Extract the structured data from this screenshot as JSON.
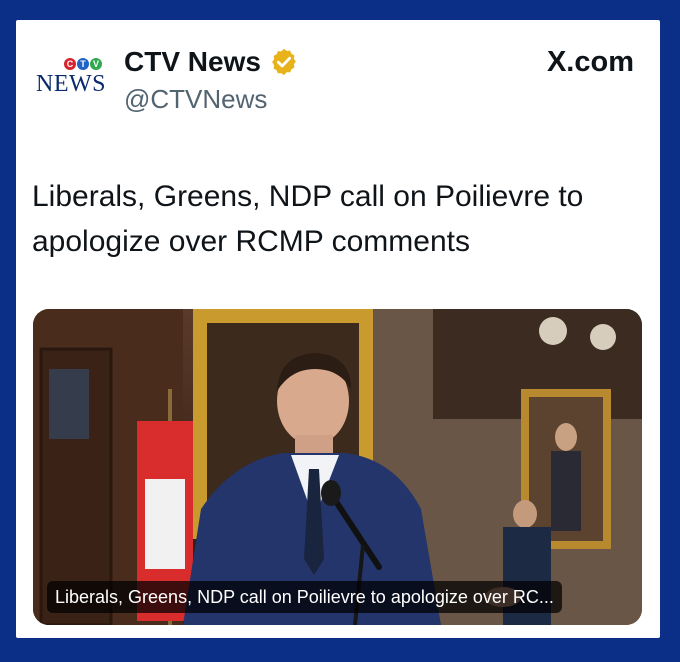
{
  "post": {
    "logo_small_letters": [
      "C",
      "T",
      "V"
    ],
    "logo_text": "NEWS",
    "account_name": "CTV News",
    "handle": "@CTVNews",
    "site_label": "X.com",
    "headline": "Liberals, Greens, NDP call on Poilievre to apologize over RCMP comments",
    "media_caption": "Liberals, Greens, NDP call on Poilievre to apologize over RC..."
  },
  "colors": {
    "page_background": "#0b2f86",
    "verified_badge": "#e8b21a",
    "ctv_red": "#d7232e",
    "ctv_blue": "#1f63c6",
    "ctv_green": "#2fa84f",
    "handle_gray": "#536471"
  },
  "icons": {
    "verified": "gold-verified-check-icon",
    "logo": "ctv-news-logo"
  }
}
